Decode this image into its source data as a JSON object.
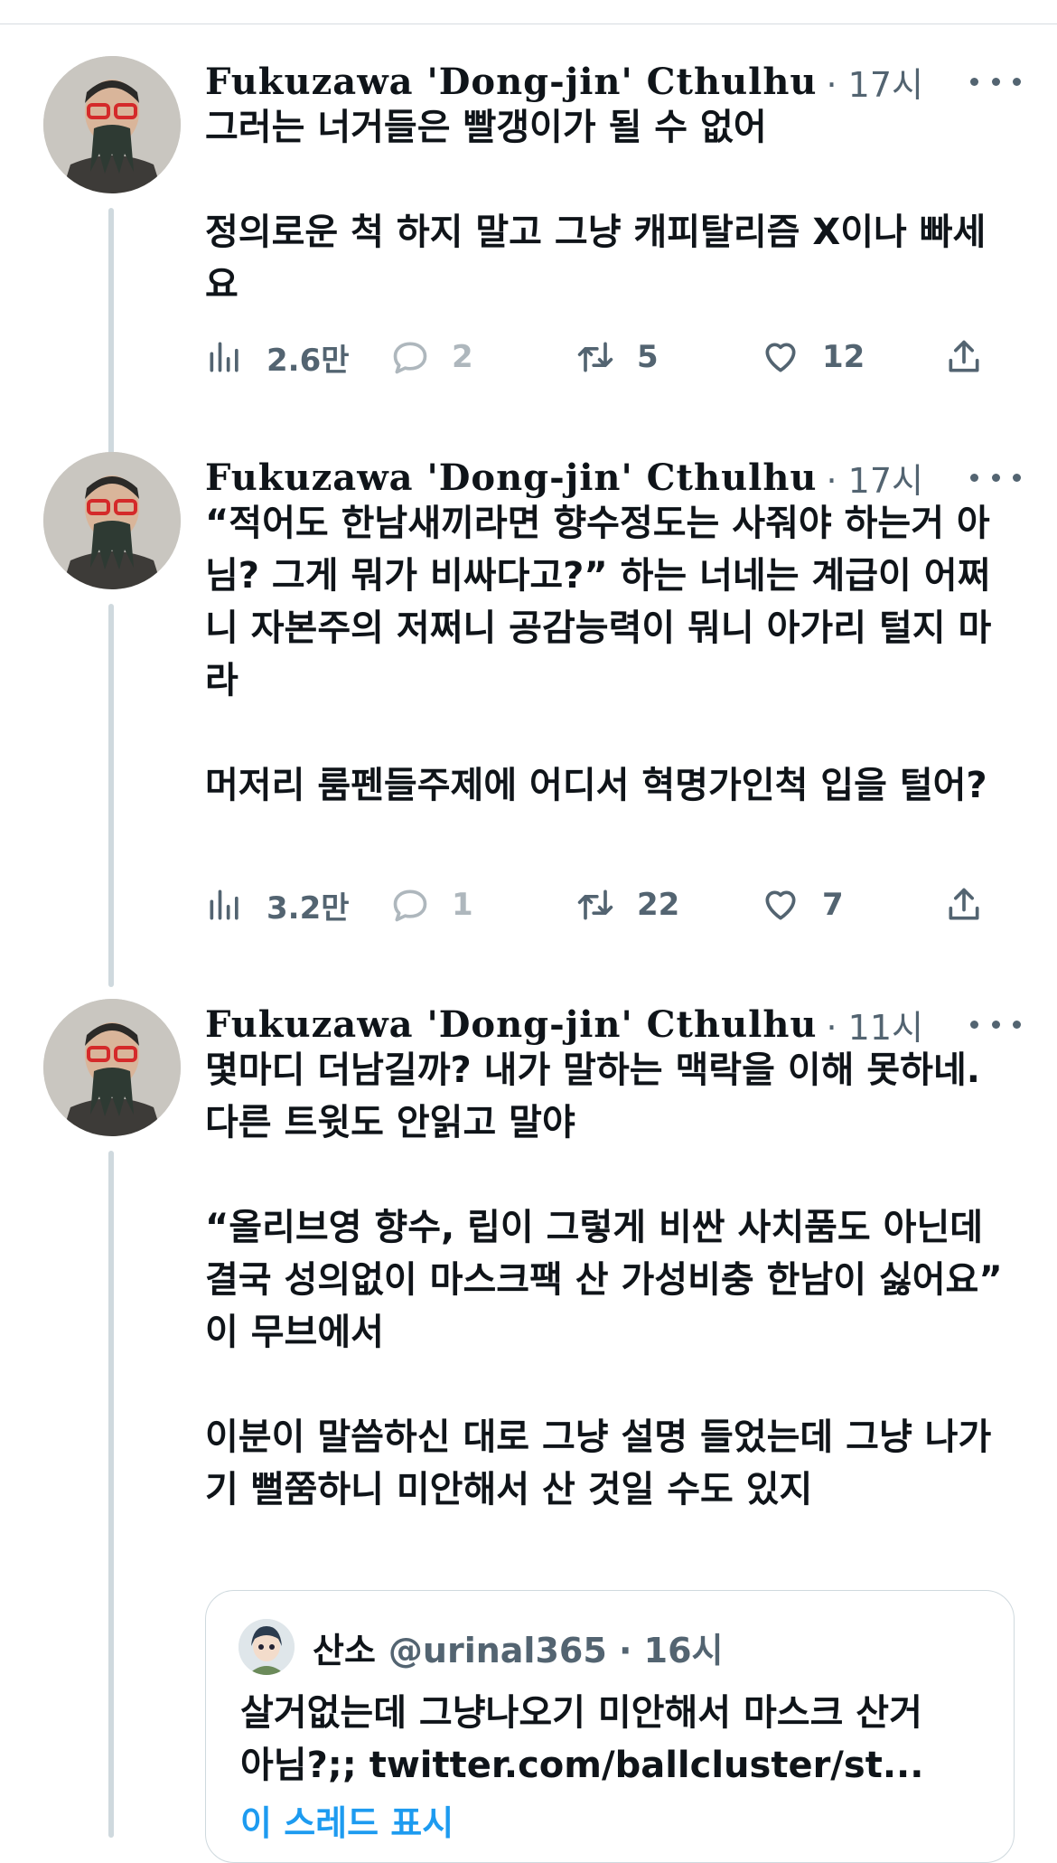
{
  "tweets": [
    {
      "author": "Fukuzawa 'Dong-jin' Cthulhu",
      "time": "· 17시",
      "paragraphs": [
        "그러는 너거들은 빨갱이가 될 수 없어",
        "",
        "정의로운 척 하지 말고 그냥 캐피탈리즘 X이나 빠세요"
      ],
      "views": "2.6만",
      "replies": "2",
      "retweets": "5",
      "likes": "12"
    },
    {
      "author": "Fukuzawa 'Dong-jin' Cthulhu",
      "time": "· 17시",
      "paragraphs": [
        "“적어도 한남새끼라면 향수정도는 사줘야 하는거 아님? 그게 뭐가 비싸다고?” 하는 너네는 계급이 어쩌니 자본주의 저쩌니 공감능력이 뭐니 아가리 털지 마라",
        "",
        "머저리 룸펜들주제에 어디서 혁명가인척 입을 털어?"
      ],
      "views": "3.2만",
      "replies": "1",
      "retweets": "22",
      "likes": "7"
    },
    {
      "author": "Fukuzawa 'Dong-jin' Cthulhu",
      "time": "· 11시",
      "paragraphs": [
        "몇마디 더남길까? 내가 말하는 맥락을 이해 못하네. 다른 트윗도 안읽고 말야",
        "",
        "“올리브영 향수, 립이 그렇게 비싼 사치품도 아닌데 결국 성의없이 마스크팩 산 가성비충 한남이 싫어요”",
        "이 무브에서",
        "",
        "이분이 말씀하신 대로 그냥 설명 들었는데 그냥 나가기 뻘쭘하니 미안해서 산 것일 수도 있지"
      ]
    }
  ],
  "quote": {
    "name": "산소",
    "handle": "@urinal365 · 16시",
    "line1": "살거없는데 그냥나오기 미안해서 마스크 산거",
    "line2": "아님?;; twitter.com/ballcluster/st...",
    "link": "이 스레드 표시"
  }
}
